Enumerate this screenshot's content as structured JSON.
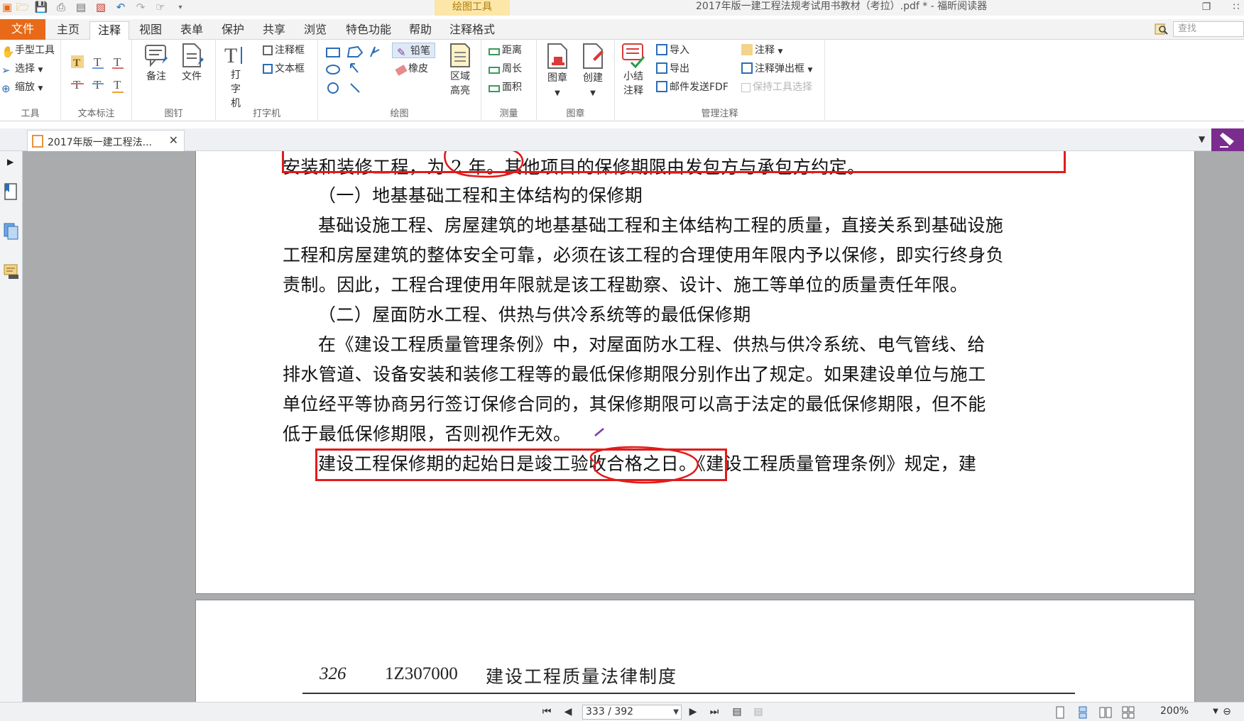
{
  "window": {
    "title": "2017年版一建工程法规考试用书教材（考拉）.pdf * - 福昕阅读器",
    "context_tab": "绘图工具"
  },
  "menu": {
    "file": "文件",
    "tabs": [
      "主页",
      "注释",
      "视图",
      "表单",
      "保护",
      "共享",
      "浏览",
      "特色功能",
      "帮助",
      "注释格式"
    ],
    "active": "注释",
    "search_placeholder": "查找"
  },
  "ribbon": {
    "tools": {
      "hand": "手型工具",
      "select": "选择",
      "zoom": "缩放",
      "label": "工具"
    },
    "text_markup": {
      "label": "文本标注"
    },
    "pin": {
      "note": "备注",
      "file": "文件",
      "label": "图钉"
    },
    "typewriter": {
      "typewriter": "打字机",
      "callout": "注释框",
      "textbox": "文本框",
      "label": "打字机"
    },
    "drawing": {
      "pencil": "铅笔",
      "eraser": "橡皮",
      "area_highlight": "区域高亮",
      "label": "绘图"
    },
    "measure": {
      "distance": "距离",
      "perimeter": "周长",
      "area": "面积",
      "label": "测量"
    },
    "stamp": {
      "stamp": "图章",
      "create": "创建",
      "label": "图章"
    },
    "manage": {
      "summary": "小结注释",
      "import": "导入",
      "export": "导出",
      "send_fdf": "邮件发送FDF",
      "comments": "注释",
      "popup": "注释弹出框",
      "keep_tool": "保持工具选择",
      "label": "管理注释"
    }
  },
  "doc_tab": {
    "label": "2017年版一建工程法..."
  },
  "document": {
    "page1_lines": [
      "安装和装修工程，为 2 年。其他项目的保修期限由发包方与承包方约定。",
      "（一）地基基础工程和主体结构的保修期",
      "基础设施工程、房屋建筑的地基基础工程和主体结构工程的质量，直接关系到基础设施",
      "工程和房屋建筑的整体安全可靠，必须在该工程的合理使用年限内予以保修，即实行终身负",
      "责制。因此，工程合理使用年限就是该工程勘察、设计、施工等单位的质量责任年限。",
      "（二）屋面防水工程、供热与供冷系统等的最低保修期",
      "在《建设工程质量管理条例》中，对屋面防水工程、供热与供冷系统、电气管线、给",
      "排水管道、设备安装和装修工程等的最低保修期限分别作出了规定。如果建设单位与施工",
      "单位经平等协商另行签订保修合同的，其保修期限可以高于法定的最低保修期限，但不能",
      "低于最低保修期限，否则视作无效。",
      "建设工程保修期的起始日是竣工验收合格之日。《建设工程质量管理条例》规定，建"
    ],
    "page2_footer": {
      "page_number": "326",
      "code": "1Z307000",
      "title": "建设工程质量法律制度"
    }
  },
  "status": {
    "page": "333 / 392",
    "zoom": "200%"
  },
  "colors": {
    "accent": "#e86a18",
    "markup": "#e21b1b",
    "brand": "#7b2c8f"
  }
}
